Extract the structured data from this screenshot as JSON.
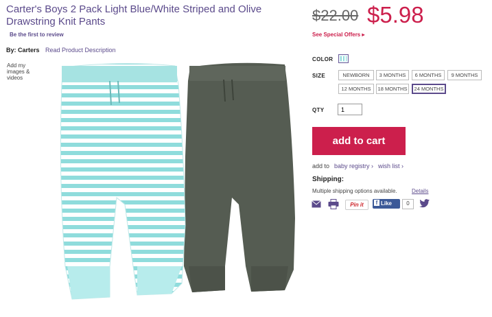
{
  "product": {
    "title": "Carter's Boys 2 Pack Light Blue/White Striped and Olive Drawstring Knit Pants",
    "review_link": "Be the first to review",
    "byline": "By: Carters",
    "read_description": "Read Product Description",
    "add_images": "Add my images & videos"
  },
  "pricing": {
    "old_price": "$22.00",
    "new_price": "$5.98",
    "special_offers": "See Special Offers ▸"
  },
  "options": {
    "color_label": "COLOR",
    "size_label": "SIZE",
    "sizes": [
      "NEWBORN",
      "3 MONTHS",
      "6 MONTHS",
      "9 MONTHS",
      "12 MONTHS",
      "18 MONTHS",
      "24 MONTHS"
    ],
    "selected_size": "24 MONTHS",
    "qty_label": "QTY",
    "qty_value": "1"
  },
  "actions": {
    "add_to_cart": "add to cart",
    "add_to": "add to",
    "baby_registry": "baby registry ›",
    "wish_list": "wish list ›"
  },
  "shipping": {
    "heading": "Shipping:",
    "text": "Multiple shipping options available.",
    "details": "Details"
  },
  "share": {
    "pinit": "Pin it",
    "fb_like": "Like",
    "fb_count": "0"
  },
  "colors": {
    "brand_purple": "#5b4a8b",
    "price_red": "#cc1f4c",
    "stripe_aqua": "#8fdcdc",
    "olive": "#555c52"
  }
}
